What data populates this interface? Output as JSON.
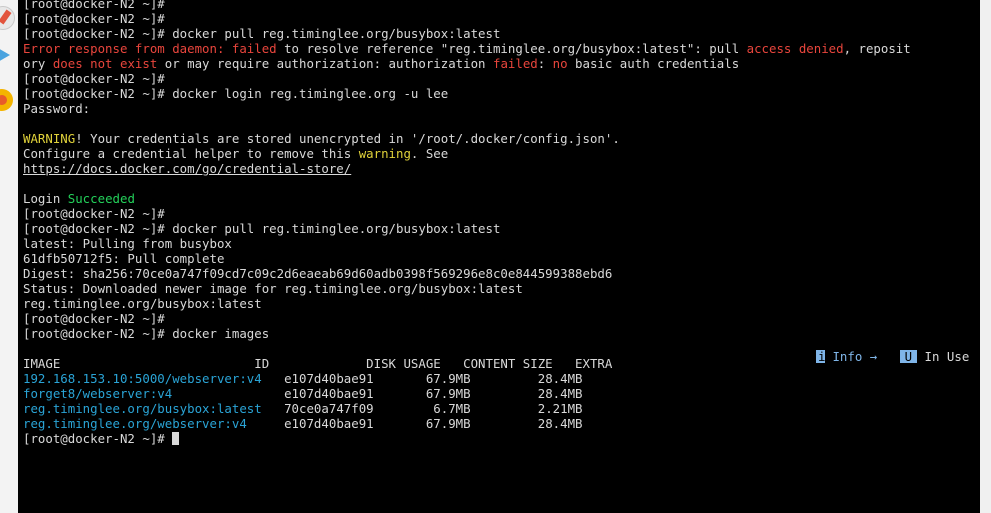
{
  "prompt": "[root@docker-N2 ~]#",
  "lines": {
    "l0": "[root@docker-N2 ~]#",
    "l1": "[root@docker-N2 ~]#",
    "l2_cmd": " docker pull reg.timinglee.org/busybox:latest",
    "l3": {
      "a": "Error response from daemon: ",
      "b": "failed",
      "c": " to resolve reference \"reg.timinglee.org/busybox:latest\": pull ",
      "d": "access denied",
      "e": ", reposit"
    },
    "l4": {
      "a": "ory ",
      "b": "does not exist",
      "c": " or may require authorization: authorization ",
      "d": "failed",
      "e": ": ",
      "f": "no",
      "g": " basic auth credentials"
    },
    "l6_cmd": " docker login reg.timinglee.org -u lee",
    "l7": "Password:",
    "l9": {
      "a": "WARNING",
      "b": "! Your credentials are stored unencrypted in '/root/.docker/config.json'."
    },
    "l10": {
      "a": "Configure a credential helper to remove this ",
      "b": "warning",
      "c": ". See"
    },
    "l11": "https://docs.docker.com/go/credential-store/",
    "l13": {
      "a": "Login ",
      "b": "Succeeded"
    },
    "l15_cmd": " docker pull reg.timinglee.org/busybox:latest",
    "l16": "latest: Pulling from busybox",
    "l17": "61dfb50712f5: Pull complete",
    "l18": "Digest: sha256:70ce0a747f09cd7c09c2d6eaeab69d60adb0398f569296e8c0e844599388ebd6",
    "l19": "Status: Downloaded newer image for reg.timinglee.org/busybox:latest",
    "l20": "reg.timinglee.org/busybox:latest",
    "l22_cmd": " docker images"
  },
  "legend": {
    "info_chip": "i",
    "info_label": " Info →",
    "inuse_chip": "U",
    "inuse_label": " In Use"
  },
  "images_table": {
    "header": "IMAGE                          ID             DISK USAGE   CONTENT SIZE   EXTRA",
    "rows": [
      {
        "image": "192.168.153.10:5000/webserver:v4",
        "rest": "   e107d40bae91       67.9MB         28.4MB"
      },
      {
        "image": "forget8/webserver:v4",
        "rest": "               e107d40bae91       67.9MB         28.4MB"
      },
      {
        "image": "reg.timinglee.org/busybox:latest",
        "rest": "   70ce0a747f09        6.7MB         2.21MB"
      },
      {
        "image": "reg.timinglee.org/webserver:v4",
        "rest": "     e107d40bae91       67.9MB         28.4MB"
      }
    ]
  },
  "colors": {
    "terminal_bg": "#000000",
    "text": "#d9d9d9",
    "error_red": "#e8453c",
    "warning_yellow": "#e0d23a",
    "success_green": "#23d15a",
    "image_blue": "#2aa4d6"
  }
}
